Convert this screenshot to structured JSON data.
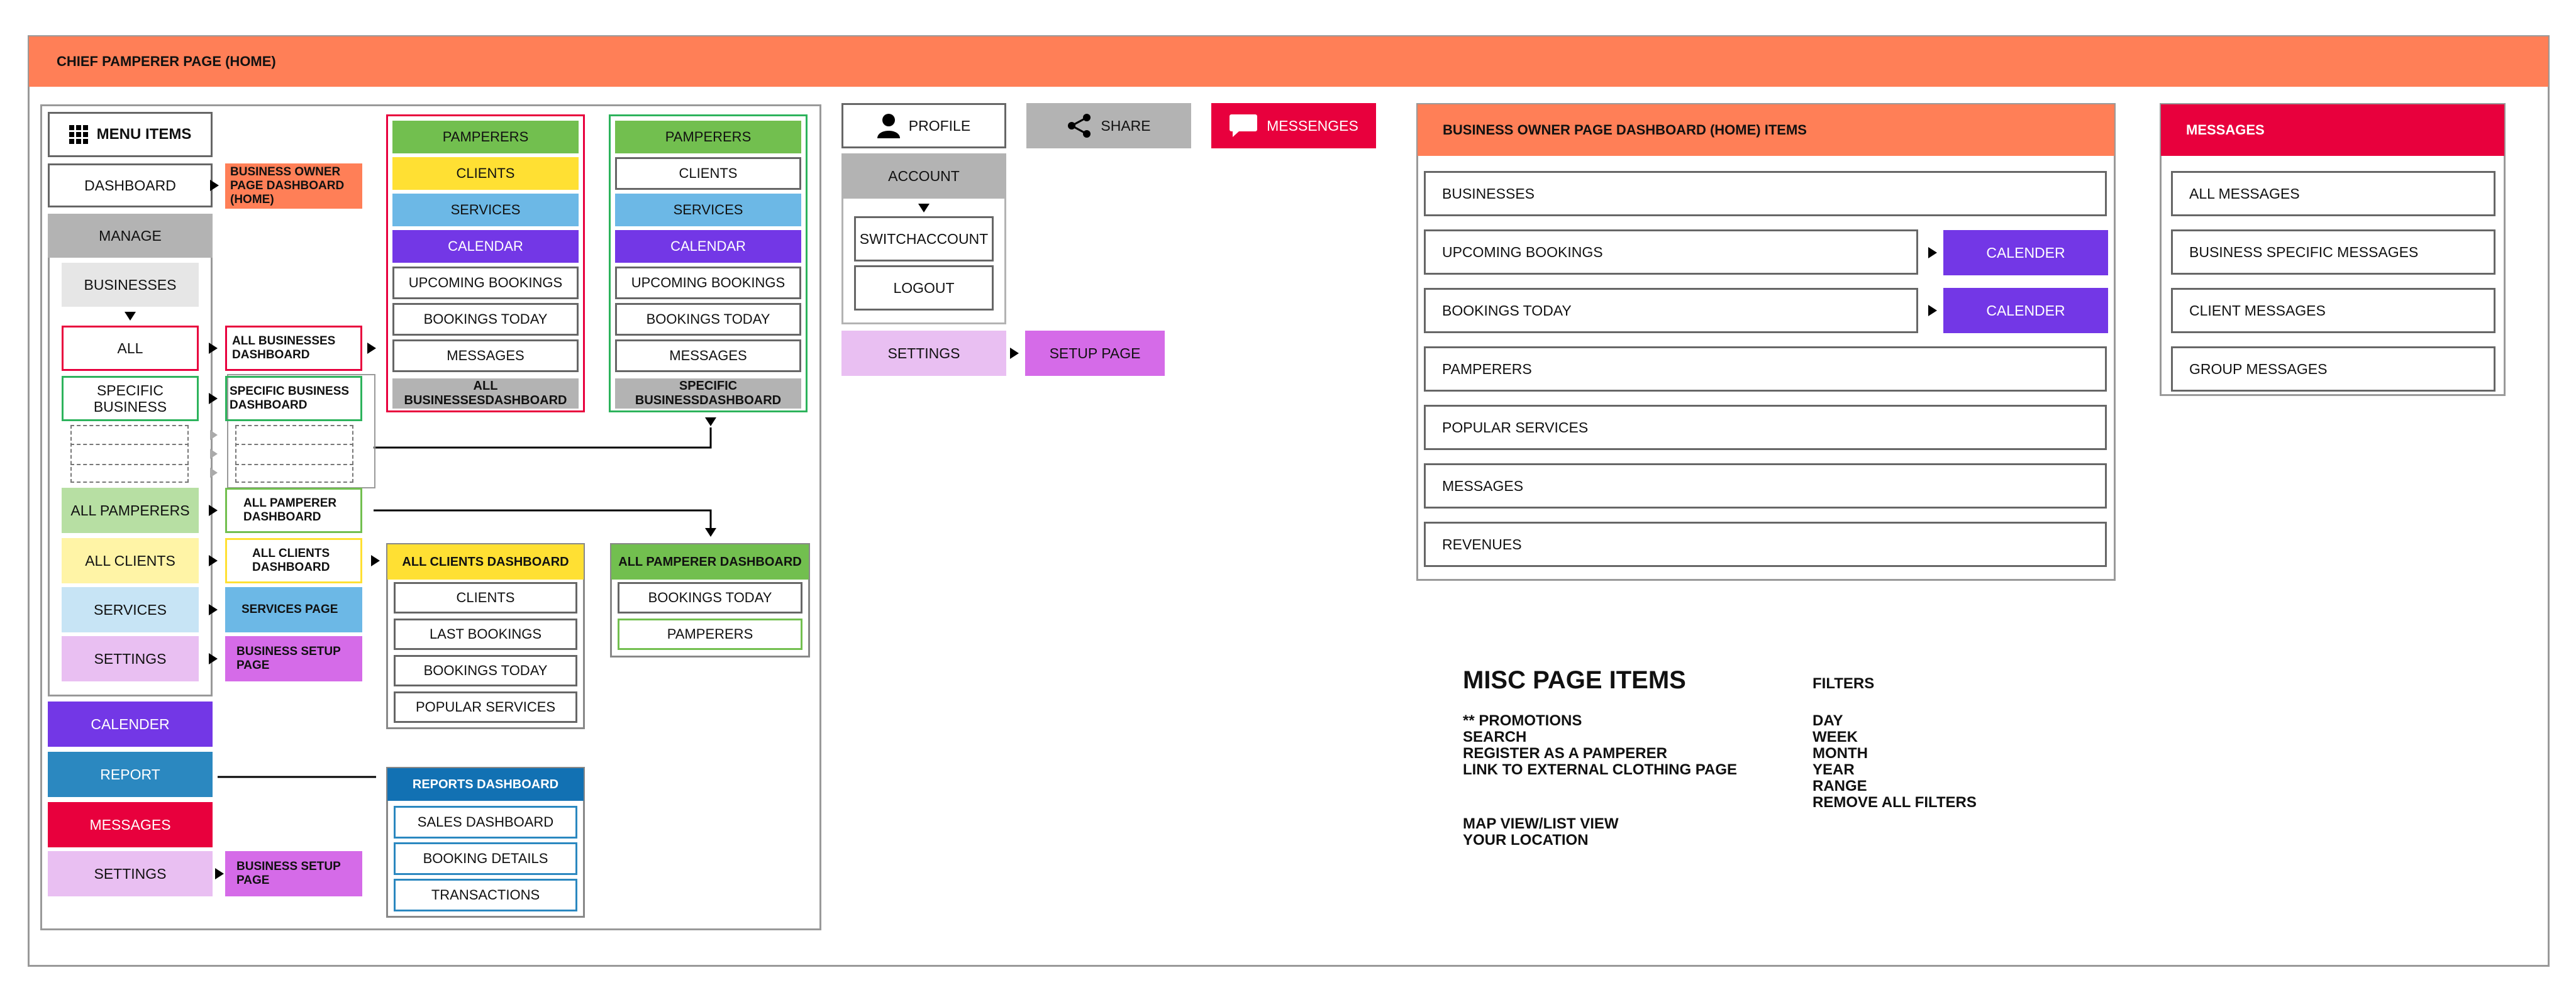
{
  "header": {
    "title": "CHIEF PAMPERER PAGE (HOME)"
  },
  "menu": {
    "title": "MENU ITEMS",
    "dashboard": "DASHBOARD",
    "manage": "MANAGE",
    "businesses": "BUSINESSES",
    "all": "ALL",
    "specific_business": "SPECIFIC BUSINESS",
    "all_pamperers": "ALL PAMPERERS",
    "all_clients": "ALL CLIENTS",
    "services": "SERVICES",
    "settings": "SETTINGS",
    "calender": "CALENDER",
    "report": "REPORT",
    "messages": "MESSAGES",
    "settings_bottom": "SETTINGS"
  },
  "labels": {
    "business_owner_dashboard": "BUSINESS OWNER PAGE DASHBOARD (HOME)",
    "all_businesses_dashboard": "ALL BUSINESSES DASHBOARD",
    "specific_business_dashboard": "SPECIFIC BUSINESS DASHBOARD",
    "all_pamperer_dashboard": "ALL PAMPERER DASHBOARD",
    "all_clients_dashboard": "ALL CLIENTS DASHBOARD",
    "services_page": "SERVICES PAGE",
    "business_setup_page": "BUSINESS SETUP PAGE",
    "business_setup_page_bottom": "BUSINESS SETUP  PAGE"
  },
  "all_businesses_panel": {
    "items": [
      "PAMPERERS",
      "CLIENTS",
      "SERVICES",
      "CALENDAR",
      "UPCOMING BOOKINGS",
      "BOOKINGS TODAY",
      "MESSAGES"
    ],
    "footer": "ALL BUSINESSESDASHBOARD"
  },
  "specific_business_panel": {
    "items": [
      "PAMPERERS",
      "CLIENTS",
      "SERVICES",
      "CALENDAR",
      "UPCOMING BOOKINGS",
      "BOOKINGS TODAY",
      "MESSAGES"
    ],
    "footer": "SPECIFIC BUSINESSDASHBOARD"
  },
  "all_clients_panel": {
    "title": "ALL CLIENTS DASHBOARD",
    "items": [
      "CLIENTS",
      "LAST BOOKINGS",
      "BOOKINGS TODAY",
      "POPULAR SERVICES"
    ]
  },
  "all_pamperer_panel": {
    "title": "ALL PAMPERER DASHBOARD",
    "items": [
      "BOOKINGS TODAY",
      "PAMPERERS"
    ]
  },
  "reports_panel": {
    "title": "REPORTS DASHBOARD",
    "items": [
      "SALES DASHBOARD",
      "BOOKING DETAILS",
      "TRANSACTIONS"
    ]
  },
  "top_actions": {
    "profile": "PROFILE",
    "share": "SHARE",
    "messenges": "MESSENGES",
    "account": "ACCOUNT",
    "switch_account": "SWITCHACCOUNT",
    "logout": "LOGOUT",
    "settings": "SETTINGS",
    "setup_page": "SETUP PAGE"
  },
  "owner_dashboard": {
    "title": "BUSINESS OWNER PAGE DASHBOARD (HOME) ITEMS",
    "items": [
      "BUSINESSES",
      "UPCOMING BOOKINGS",
      "BOOKINGS TODAY",
      "PAMPERERS",
      "POPULAR SERVICES",
      "MESSAGES",
      "REVENUES"
    ],
    "calender_label": "CALENDER"
  },
  "messages_panel": {
    "title": "MESSAGES",
    "items": [
      "ALL MESSAGES",
      "BUSINESS SPECIFIC MESSAGES",
      "CLIENT MESSAGES",
      "GROUP MESSAGES"
    ]
  },
  "misc": {
    "title": "MISC PAGE ITEMS",
    "items": [
      "** PROMOTIONS",
      "SEARCH",
      "REGISTER AS A PAMPERER",
      "LINK TO EXTERNAL CLOTHING PAGE"
    ],
    "items2": [
      "MAP VIEW/LIST VIEW",
      "YOUR LOCATION"
    ]
  },
  "filters": {
    "title": "FILTERS",
    "items": [
      "DAY",
      "WEEK",
      "MONTH",
      "YEAR",
      "RANGE",
      "REMOVE ALL FILTERS"
    ]
  },
  "colors": {
    "header_orange": "#FF7F57",
    "green": "#72BF4F",
    "yellow": "#FFE033",
    "blue": "#6CB8E6",
    "purple": "#7337E6",
    "pink": "#E8003D",
    "report_blue": "#2B88C0",
    "reports_header": "#1271B3",
    "magenta_light": "#E9BFF2",
    "magenta": "#D56BE8",
    "gray": "#B3B3B3"
  }
}
